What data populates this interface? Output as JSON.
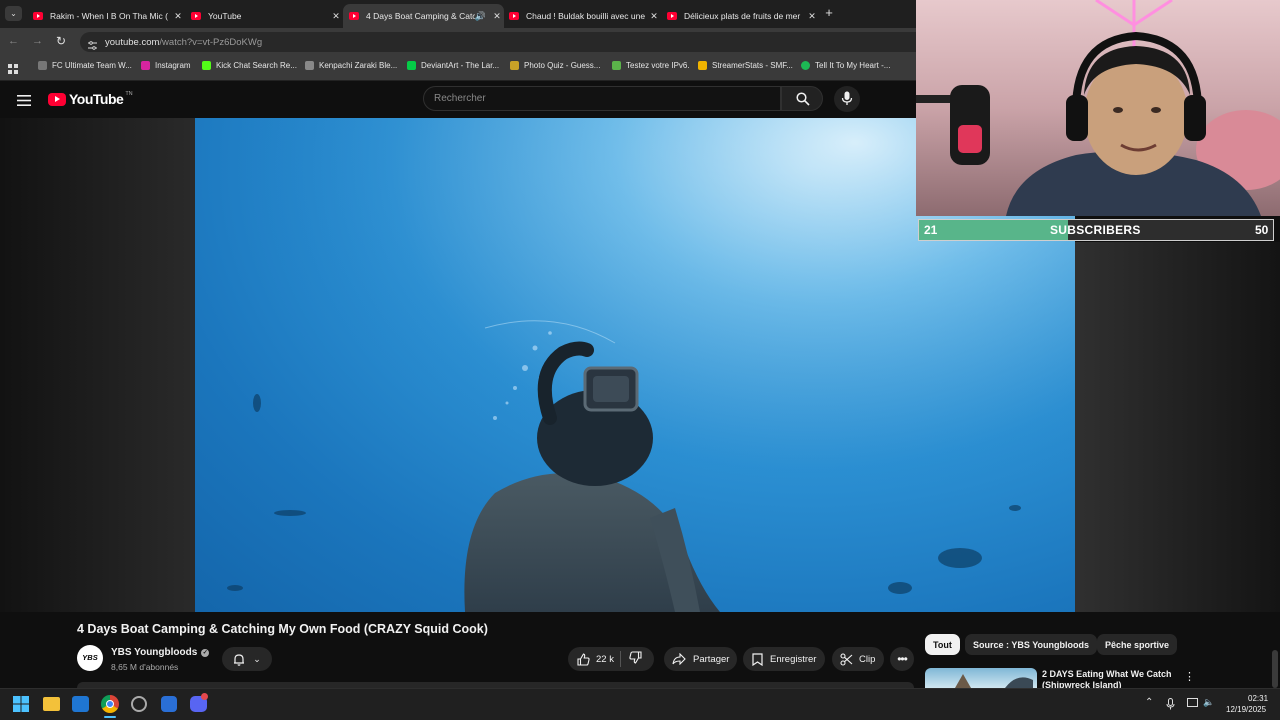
{
  "browser": {
    "tabs": [
      {
        "title": "Rakim - When I B On Tha Mic (",
        "active": false
      },
      {
        "title": "YouTube",
        "active": false
      },
      {
        "title": "4 Days Boat Camping & Catc",
        "active": true
      },
      {
        "title": "Chaud ! Buldak bouilli avec une",
        "active": false
      },
      {
        "title": "Délicieux plats de fruits de mer",
        "active": false
      }
    ],
    "url_host": "youtube.com",
    "url_path": "/watch?v=vt-Pz6DoKWg",
    "bookmarks": [
      {
        "label": "FC Ultimate Team W...",
        "color": "#3a3a3a"
      },
      {
        "label": "Instagram",
        "color": "#d6249f"
      },
      {
        "label": "Kick Chat Search Re...",
        "color": "#53fc18"
      },
      {
        "label": "Kenpachi Zaraki Ble...",
        "color": "#888888"
      },
      {
        "label": "DeviantArt - The Lar...",
        "color": "#05cc47"
      },
      {
        "label": "Photo Quiz - Guess...",
        "color": "#c9a227"
      },
      {
        "label": "Testez votre IPv6.",
        "color": "#5bb34a"
      },
      {
        "label": "StreamerStats - SMF...",
        "color": "#f0b400"
      },
      {
        "label": "Tell It To My Heart -...",
        "color": "#1db954"
      }
    ]
  },
  "youtube": {
    "logo_text": "YouTube",
    "logo_sup": "TN",
    "search_placeholder": "Rechercher",
    "video_title": "4 Days Boat Camping & Catching My Own Food (CRAZY Squid Cook)",
    "channel_avatar_text": "YBS",
    "channel_name": "YBS Youngbloods",
    "subscribers": "8,65 M d'abonnés",
    "likes": "22 k",
    "share_label": "Partager",
    "save_label": "Enregistrer",
    "clip_label": "Clip",
    "chips": [
      "Tout",
      "Source : YBS Youngbloods",
      "Pêche sportive"
    ],
    "related": {
      "title_line1": "2 DAYS Eating What We Catch",
      "title_line2": "(Shipwreck Island)"
    }
  },
  "overlay": {
    "sub_count": "21",
    "sub_label": "SUBSCRIBERS",
    "sub_goal": "50",
    "progress": 0.42
  },
  "taskbar": {
    "time": "02:31",
    "date": "12/19/2025"
  },
  "colors": {
    "youtube_red": "#ff0033",
    "sub_fill": "#58b58a"
  }
}
